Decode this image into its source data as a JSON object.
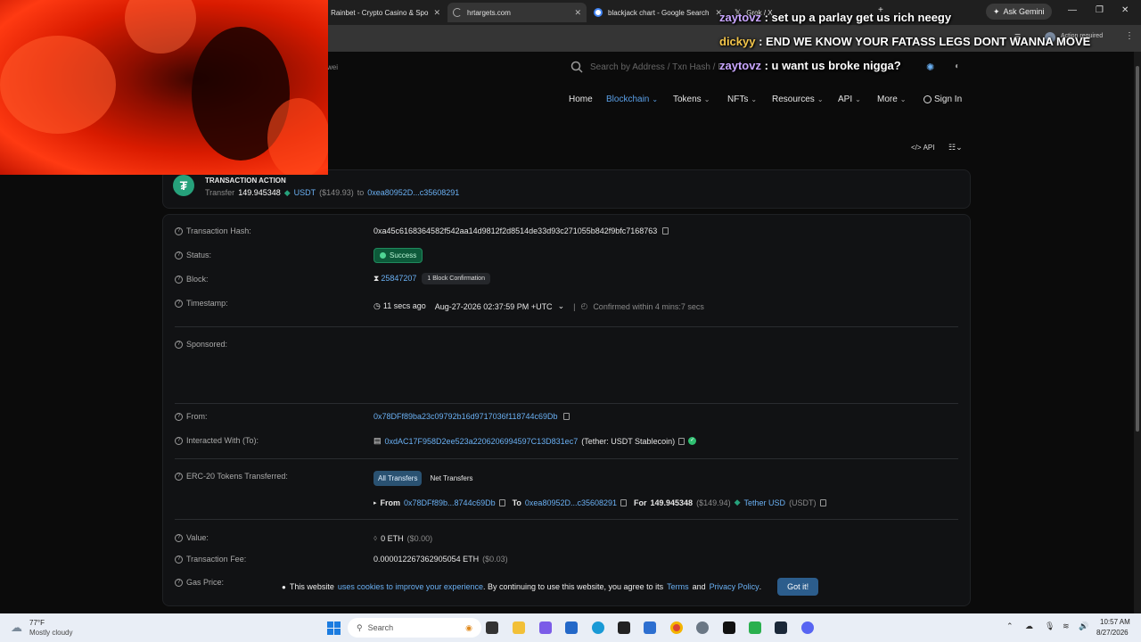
{
  "browser": {
    "tabs": [
      {
        "title": "Rainbet - Crypto Casino & Spo",
        "icon": "rainbet-favicon",
        "active": false
      },
      {
        "title": "hrtargets.com",
        "icon": "loading-spinner-icon",
        "active": true
      },
      {
        "title": "blackjack chart - Google Search",
        "icon": "google-favicon",
        "active": false
      },
      {
        "title": "Grok / X",
        "icon": "x-favicon",
        "active": false
      }
    ],
    "gemini_label": "Ask Gemini",
    "profile_label": "Action required"
  },
  "chat": [
    {
      "user": "zaytovz",
      "message": " : set up a parlay get us rich neegy"
    },
    {
      "user": "dickyy",
      "message": " : END WE KNOW YOUR FATASS LEGS DONT WANNA MOVE"
    },
    {
      "user": "zaytovz",
      "message": " : u want us broke nigga?"
    }
  ],
  "header": {
    "gas_fragment": "wei",
    "search_placeholder": "Search by Address / Txn Hash / B",
    "nav": [
      {
        "label": "Home",
        "has_chevron": false,
        "active": false
      },
      {
        "label": "Blockchain",
        "has_chevron": true,
        "active": true
      },
      {
        "label": "Tokens",
        "has_chevron": true,
        "active": false
      },
      {
        "label": "NFTs",
        "has_chevron": true,
        "active": false
      },
      {
        "label": "Resources",
        "has_chevron": true,
        "active": false
      },
      {
        "label": "API",
        "has_chevron": true,
        "active": false
      },
      {
        "label": "More",
        "has_chevron": true,
        "active": false
      }
    ],
    "sign_in": "Sign In",
    "api_link": "API"
  },
  "action": {
    "heading": "TRANSACTION ACTION",
    "verb": "Transfer",
    "amount": "149.945348",
    "token": "USDT",
    "usd": "($149.93)",
    "to_word": "to",
    "to_address": "0xea80952D...c35608291"
  },
  "details": {
    "tx_hash": {
      "label": "Transaction Hash:",
      "value": "0xa45c6168364582f542aa14d9812f2d8514de33d93c271055b842f9bfc7168763"
    },
    "status": {
      "label": "Status:",
      "value": "Success"
    },
    "block": {
      "label": "Block:",
      "value": "25847207",
      "confirmations": "1 Block Confirmation"
    },
    "timestamp": {
      "label": "Timestamp:",
      "ago": "11 secs ago",
      "date": "Aug-27-2026 02:37:59 PM +UTC",
      "confirmed": "Confirmed within 4 mins:7 secs"
    },
    "sponsored": {
      "label": "Sponsored:"
    },
    "from": {
      "label": "From:",
      "value": "0x78DFf89ba23c09792b16d9717036f118744c69Db"
    },
    "to": {
      "label": "Interacted With (To):",
      "value": "0xdAC17F958D2ee523a2206206994597C13D831ec7",
      "name": "(Tether: USDT Stablecoin)"
    },
    "erc20": {
      "label": "ERC-20 Tokens Transferred:",
      "tabs": [
        "All Transfers",
        "Net Transfers"
      ],
      "from_word": "From",
      "from_addr": "0x78DFf89b...8744c69Db",
      "to_word": "To",
      "to_addr": "0xea80952D...c35608291",
      "for_word": "For",
      "amount": "149.945348",
      "usd": "($149.94)",
      "token_name": "Tether USD",
      "token_symbol": "(USDT)"
    },
    "value": {
      "label": "Value:",
      "amount": "0 ETH",
      "usd": "($0.00)"
    },
    "fee": {
      "label": "Transaction Fee:",
      "amount": "0.000012267362905054 ETH",
      "usd": "($0.03)"
    },
    "gas_price": {
      "label": "Gas Price:"
    }
  },
  "cookie": {
    "prefix": "This website",
    "link1": "uses cookies to improve your experience",
    "middle": ". By continuing to use this website, you agree to its",
    "terms": "Terms",
    "and": "and",
    "privacy": "Privacy Policy",
    "period": ".",
    "button": "Got it!"
  },
  "taskbar": {
    "weather_temp": "77°F",
    "weather_desc": "Mostly cloudy",
    "search_placeholder": "Search",
    "time": "10:57 AM",
    "date": "8/27/2026"
  },
  "colors": {
    "accent": "#5aa0e8",
    "success": "#0d5a3a",
    "tether": "#26a17b",
    "webcam_red": "#d91b00"
  }
}
